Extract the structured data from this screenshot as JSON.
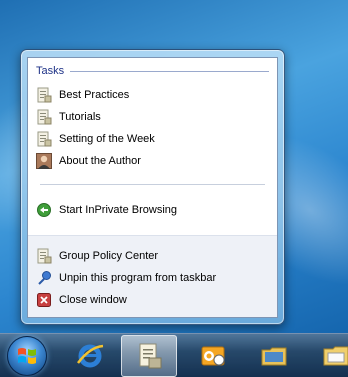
{
  "jump_list": {
    "tasks_header": "Tasks",
    "tasks": [
      {
        "label": "Best Practices",
        "icon": "document-icon"
      },
      {
        "label": "Tutorials",
        "icon": "document-icon"
      },
      {
        "label": "Setting of the Week",
        "icon": "document-icon"
      },
      {
        "label": "About the Author",
        "icon": "author-photo-icon"
      }
    ],
    "inprivate_label": "Start InPrivate Browsing",
    "footer": [
      {
        "label": "Group Policy Center",
        "icon": "document-icon"
      },
      {
        "label": "Unpin this program from taskbar",
        "icon": "unpin-icon"
      },
      {
        "label": "Close window",
        "icon": "close-window-icon"
      }
    ]
  },
  "taskbar": {
    "buttons": [
      {
        "name": "internet-explorer-icon"
      },
      {
        "name": "group-policy-center-icon",
        "active": true
      },
      {
        "name": "outlook-icon"
      },
      {
        "name": "folder-icon"
      },
      {
        "name": "explorer-icon"
      }
    ]
  },
  "colors": {
    "header_text": "#1e3287",
    "taskbar": "#2a4d72",
    "accent": "#3b86d0"
  }
}
